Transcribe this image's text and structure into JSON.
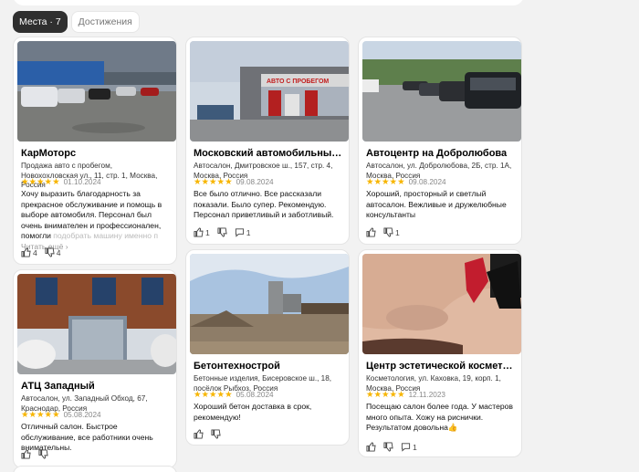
{
  "tabs": [
    {
      "label": "Места · 7"
    },
    {
      "label": "Достижения"
    }
  ],
  "cards": [
    {
      "title": "КарМоторс",
      "address": "Продажа авто с пробегом, Новохохловская ул., 11, стр. 1, Москва, Россия",
      "stars": "★★★★★",
      "date": "01.10.2024",
      "text": "Хочу выразить благодарность за прекрасное обслуживание и помощь в выборе автомобиля. Персонал был очень внимателен и профессионален, помогли",
      "text_fade": "подобрать машину именно п",
      "more": "Читать ещё ›",
      "likes": "4",
      "dislikes": "4"
    },
    {
      "title": "Московский автомобильный дом",
      "address": "Автосалон, Дмитровское ш., 157, стр. 4, Москва, Россия",
      "stars": "★★★★★",
      "date": "09.08.2024",
      "text": "Все было отлично. Все рассказали показали. Было супер. Рекомендую. Персонал приветливый и заботливый.",
      "likes": "1",
      "comments": "1",
      "sign": "АВТО С ПРОБЕГОМ"
    },
    {
      "title": "Автоцентр на Добролюбова",
      "address": "Автосалон, ул. Добролюбова, 2Б, стр. 1А, Москва, Россия",
      "stars": "★★★★★",
      "date": "09.08.2024",
      "text": "Хороший, просторный и светлый автосалон. Вежливые и дружелюбные консультанты",
      "dislikes": "1"
    },
    {
      "title": "АТЦ Западный",
      "address": "Автосалон, ул. Западный Обход, 67, Краснодар, Россия",
      "stars": "★★★★★",
      "date": "05.08.2024",
      "text": "Отличный салон. Быстрое обслуживание, все работники очень внимательны."
    },
    {
      "title": "Бетонтехнострой",
      "address": "Бетонные изделия, Бисеровское ш., 18, посёлок Рыбхоз, Россия",
      "stars": "★★★★★",
      "date": "05.08.2024",
      "text": "Хороший бетон доставка в срок, рекомендую!"
    },
    {
      "title": "Центр эстетической косметологии",
      "address": "Косметология, ул. Каховка, 19, корп. 1, Москва, Россия",
      "stars": "★★★★★",
      "date": "12.11.2023",
      "text": "Посещаю салон более года. У мастеров много опыта. Хожу на риснички. Результатом  довольна👍",
      "comments": "1"
    }
  ]
}
